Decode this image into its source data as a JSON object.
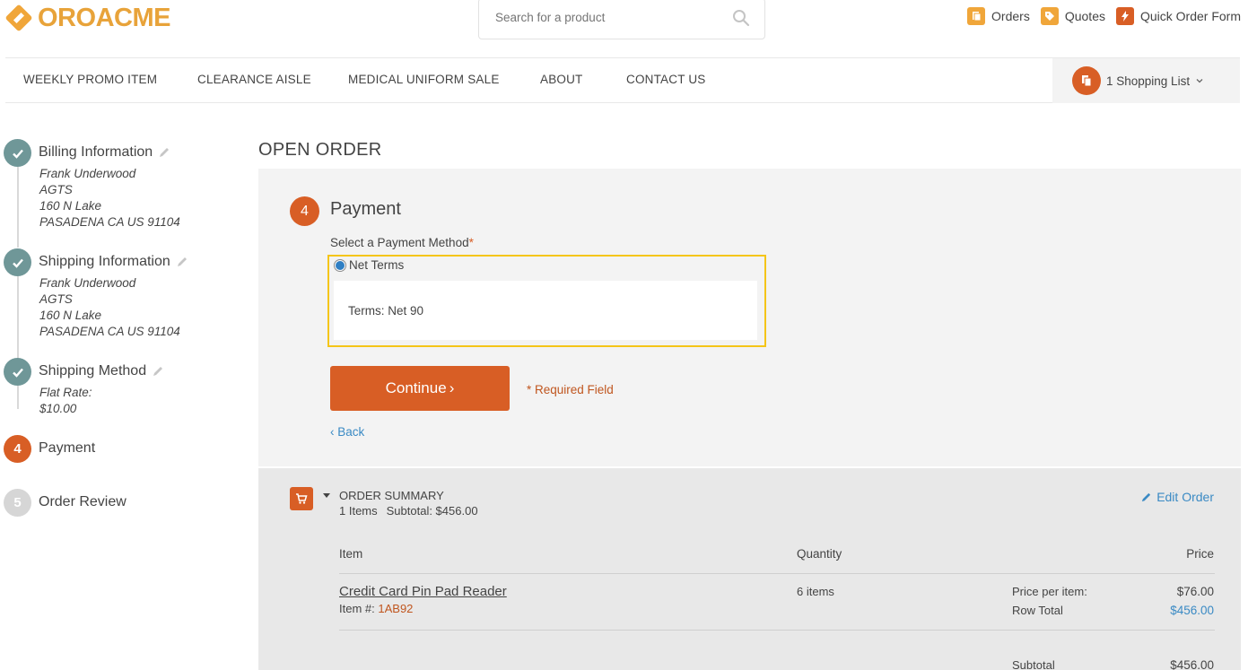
{
  "brand": {
    "logo_left": "ORO",
    "logo_right": "ACME"
  },
  "search": {
    "placeholder": "Search for a product"
  },
  "top_links": [
    {
      "label": "Orders",
      "icon": "orders-icon",
      "color": "#f0a63a"
    },
    {
      "label": "Quotes",
      "icon": "quotes-icon",
      "color": "#f0a63a"
    },
    {
      "label": "Quick Order Form",
      "icon": "quick-order-icon",
      "color": "#d85e25"
    }
  ],
  "nav": {
    "items": [
      "WEEKLY PROMO ITEM",
      "CLEARANCE AISLE",
      "MEDICAL UNIFORM SALE",
      "ABOUT",
      "CONTACT US"
    ],
    "shopping_list": "1 Shopping List"
  },
  "steps": [
    {
      "num": "1",
      "title": "Billing Information",
      "status": "done",
      "details": [
        "Frank Underwood",
        "AGTS",
        "160 N Lake",
        "PASADENA CA US 91104"
      ]
    },
    {
      "num": "2",
      "title": "Shipping Information",
      "status": "done",
      "details": [
        "Frank Underwood",
        "AGTS",
        "160 N Lake",
        "PASADENA CA US 91104"
      ]
    },
    {
      "num": "3",
      "title": "Shipping Method",
      "status": "done",
      "details": [
        "Flat Rate:",
        "$10.00"
      ]
    },
    {
      "num": "4",
      "title": "Payment",
      "status": "active",
      "details": []
    },
    {
      "num": "5",
      "title": "Order Review",
      "status": "todo",
      "details": []
    }
  ],
  "main": {
    "page_title": "OPEN ORDER",
    "payment": {
      "step_num": "4",
      "title": "Payment",
      "method_label": "Select a Payment Method",
      "required_star": "*",
      "option_label": "Net Terms",
      "terms_text": "Terms: Net 90",
      "continue_label": "Continue",
      "continue_chevron": "›",
      "required_note": "* Required Field",
      "back_chevron": "‹",
      "back_label": "Back"
    },
    "summary": {
      "title": "ORDER SUMMARY",
      "items_count": "1 Items",
      "subtotal_meta": "Subtotal: $456.00",
      "edit_label": "Edit Order",
      "headers": {
        "item": "Item",
        "quantity": "Quantity",
        "price": "Price"
      },
      "line": {
        "name": "Credit Card Pin Pad Reader",
        "item_num_label": "Item #:",
        "sku": "1AB92",
        "quantity": "6 items",
        "price_per_item_label": "Price per item:",
        "price_per_item": "$76.00",
        "row_total_label": "Row Total",
        "row_total": "$456.00"
      },
      "subtotal_label": "Subtotal",
      "subtotal_value": "$456.00"
    }
  },
  "colors": {
    "accent": "#d85e25",
    "done": "#6f9798",
    "link": "#3a8ac4",
    "highlight": "#f5c518"
  }
}
